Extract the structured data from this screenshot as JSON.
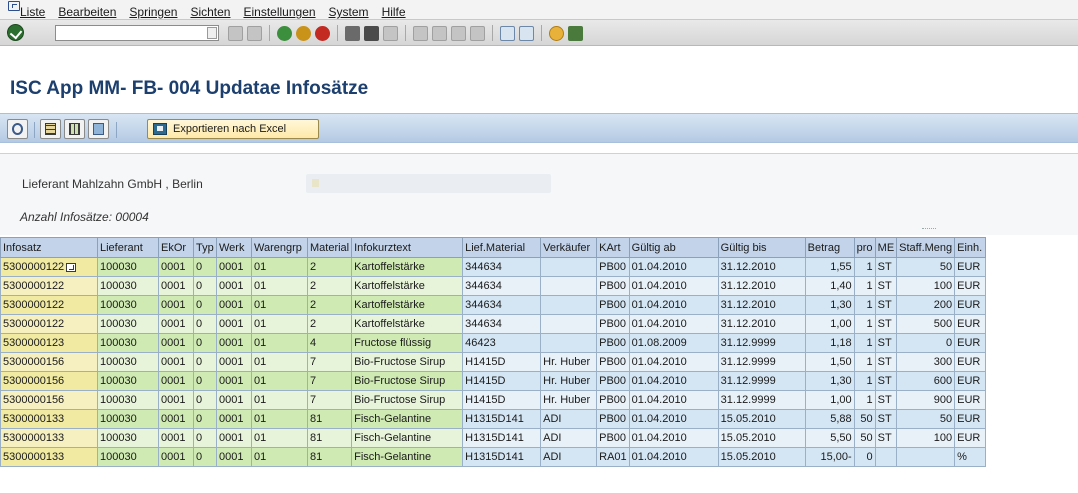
{
  "menu": [
    "Liste",
    "Bearbeiten",
    "Springen",
    "Sichten",
    "Einstellungen",
    "System",
    "Hilfe"
  ],
  "title": "ISC App MM- FB- 004 Updatae Infosätze",
  "toolbar": {
    "export_label": "Exportieren nach Excel"
  },
  "header": {
    "supplier": "Lieferant Mahlzahn GmbH , Berlin",
    "count": "Anzahl Infosätze: 00004"
  },
  "table": {
    "columns": [
      "Infosatz",
      "Lieferant",
      "EkOr",
      "Typ",
      "Werk",
      "Warengrp",
      "Material",
      "Infokurztext",
      "Lief.Material",
      "Verkäufer",
      "KArt",
      "Gültig ab",
      "Gültig bis",
      "Betrag",
      "pro",
      "ME",
      "Staff.Meng",
      "Einh."
    ],
    "rows": [
      [
        "5300000122",
        "100030",
        "0001",
        "0",
        "0001",
        "01",
        "2",
        "Kartoffelstärke",
        "344634",
        "",
        "PB00",
        "01.04.2010",
        "31.12.2010",
        "1,55",
        "1",
        "ST",
        "50",
        "EUR"
      ],
      [
        "5300000122",
        "100030",
        "0001",
        "0",
        "0001",
        "01",
        "2",
        "Kartoffelstärke",
        "344634",
        "",
        "PB00",
        "01.04.2010",
        "31.12.2010",
        "1,40",
        "1",
        "ST",
        "100",
        "EUR"
      ],
      [
        "5300000122",
        "100030",
        "0001",
        "0",
        "0001",
        "01",
        "2",
        "Kartoffelstärke",
        "344634",
        "",
        "PB00",
        "01.04.2010",
        "31.12.2010",
        "1,30",
        "1",
        "ST",
        "200",
        "EUR"
      ],
      [
        "5300000122",
        "100030",
        "0001",
        "0",
        "0001",
        "01",
        "2",
        "Kartoffelstärke",
        "344634",
        "",
        "PB00",
        "01.04.2010",
        "31.12.2010",
        "1,00",
        "1",
        "ST",
        "500",
        "EUR"
      ],
      [
        "5300000123",
        "100030",
        "0001",
        "0",
        "0001",
        "01",
        "4",
        "Fructose flüssig",
        "46423",
        "",
        "PB00",
        "01.08.2009",
        "31.12.9999",
        "1,18",
        "1",
        "ST",
        "0",
        "EUR"
      ],
      [
        "5300000156",
        "100030",
        "0001",
        "0",
        "0001",
        "01",
        "7",
        "Bio-Fructose Sirup",
        "H1415D",
        "Hr. Huber",
        "PB00",
        "01.04.2010",
        "31.12.9999",
        "1,50",
        "1",
        "ST",
        "300",
        "EUR"
      ],
      [
        "5300000156",
        "100030",
        "0001",
        "0",
        "0001",
        "01",
        "7",
        "Bio-Fructose Sirup",
        "H1415D",
        "Hr. Huber",
        "PB00",
        "01.04.2010",
        "31.12.9999",
        "1,30",
        "1",
        "ST",
        "600",
        "EUR"
      ],
      [
        "5300000156",
        "100030",
        "0001",
        "0",
        "0001",
        "01",
        "7",
        "Bio-Fructose Sirup",
        "H1415D",
        "Hr. Huber",
        "PB00",
        "01.04.2010",
        "31.12.9999",
        "1,00",
        "1",
        "ST",
        "900",
        "EUR"
      ],
      [
        "5300000133",
        "100030",
        "0001",
        "0",
        "0001",
        "01",
        "81",
        "Fisch-Gelantine",
        "H1315D141",
        "ADI",
        "PB00",
        "01.04.2010",
        "15.05.2010",
        "5,88",
        "50",
        "ST",
        "50",
        "EUR"
      ],
      [
        "5300000133",
        "100030",
        "0001",
        "0",
        "0001",
        "01",
        "81",
        "Fisch-Gelantine",
        "H1315D141",
        "ADI",
        "PB00",
        "01.04.2010",
        "15.05.2010",
        "5,50",
        "50",
        "ST",
        "100",
        "EUR"
      ],
      [
        "5300000133",
        "100030",
        "0001",
        "0",
        "0001",
        "01",
        "81",
        "Fisch-Gelantine",
        "H1315D141",
        "ADI",
        "RA01",
        "01.04.2010",
        "15.05.2010",
        "15,00-",
        "0",
        "",
        "",
        "%"
      ]
    ]
  }
}
